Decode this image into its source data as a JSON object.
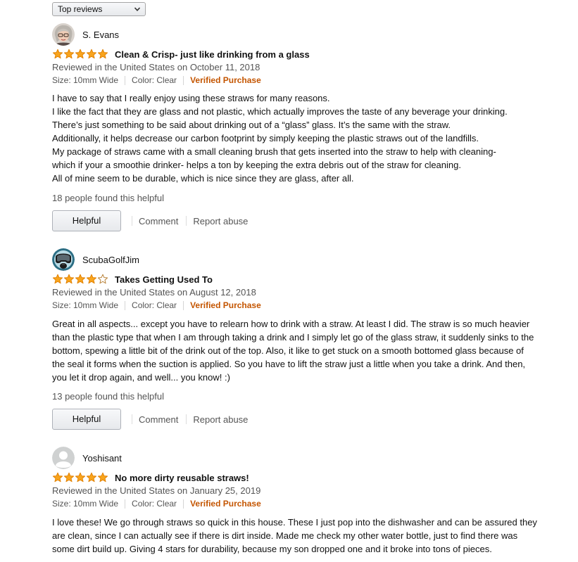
{
  "sort": {
    "selected": "Top reviews"
  },
  "colors": {
    "star": "#f8a41d",
    "star_outline": "#e07f00",
    "verified": "#c45500",
    "meta_text": "#555555"
  },
  "reviews": [
    {
      "name": "S. Evans",
      "avatar_icon": "profile-photo",
      "rating": 5,
      "title": "Clean & Crisp- just like drinking from a glass",
      "date": "Reviewed in the United States on October 11, 2018",
      "size": "Size: 10mm Wide",
      "color": "Color: Clear",
      "verified": "Verified Purchase",
      "body": [
        "I have to say that I really enjoy using these straws for many reasons.",
        "I like the fact that they are glass and not plastic, which actually improves the taste of any beverage your drinking.",
        "There’s just something to be said about drinking out of a “glass” glass. It’s the same with the straw.",
        "Additionally, it helps decrease our carbon footprint by simply keeping the plastic straws out of the landfills.",
        "My package of straws came with a small cleaning brush that gets inserted into the straw to help with cleaning-",
        "which if your a smoothie drinker- helps a ton by keeping the extra debris out of the straw for cleaning.",
        "All of mine seem to be durable, which is nice since they are glass, after all."
      ],
      "helpful_count": "18 people found this helpful",
      "helpful_label": "Helpful",
      "comment_label": "Comment",
      "report_label": "Report abuse"
    },
    {
      "name": "ScubaGolfJim",
      "avatar_icon": "scuba-mask-photo",
      "rating": 4,
      "title": "Takes Getting Used To",
      "date": "Reviewed in the United States on August 12, 2018",
      "size": "Size: 10mm Wide",
      "color": "Color: Clear",
      "verified": "Verified Purchase",
      "body": [
        "Great in all aspects... except you have to relearn how to drink with a straw. At least I did. The straw is so much heavier than the plastic type that when I am through taking a drink and I simply let go of the glass straw, it suddenly sinks to the bottom, spewing a little bit of the drink out of the top. Also, it like to get stuck on a smooth bottomed glass because of the seal it forms when the suction is applied. So you have to lift the straw just a little when you take a drink. And then, you let it drop again, and well... you know! :)"
      ],
      "helpful_count": "13 people found this helpful",
      "helpful_label": "Helpful",
      "comment_label": "Comment",
      "report_label": "Report abuse"
    },
    {
      "name": "Yoshisant",
      "avatar_icon": "default-user-icon",
      "rating": 5,
      "title": "No more dirty reusable straws!",
      "date": "Reviewed in the United States on January 25, 2019",
      "size": "Size: 10mm Wide",
      "color": "Color: Clear",
      "verified": "Verified Purchase",
      "body": [
        "I love these! We go through straws so quick in this house. These I just pop into the dishwasher and can be assured they are clean, since I can actually see if there is dirt inside. Made me check my other water bottle, just to find there was some dirt build up. Giving 4 stars for durability, because my son dropped one and it broke into tons of pieces."
      ]
    }
  ]
}
